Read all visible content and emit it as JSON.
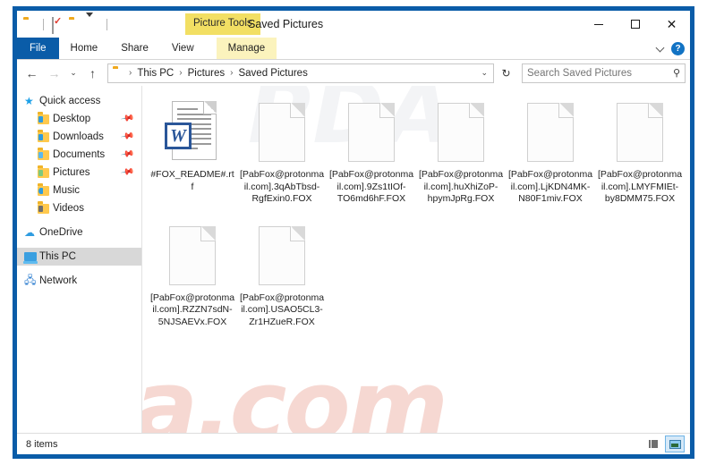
{
  "window": {
    "title": "Saved Pictures",
    "contextual_tab_label": "Picture Tools",
    "minimize": "–",
    "maximize": "□",
    "close": "✕"
  },
  "quick_access_toolbar": {
    "items": [
      {
        "name": "folder-icon",
        "label": ""
      },
      {
        "name": "properties-icon",
        "label": ""
      },
      {
        "name": "new-folder-icon",
        "label": ""
      },
      {
        "name": "customize-dropdown-icon",
        "label": ""
      }
    ]
  },
  "ribbon": {
    "file_tab": "File",
    "tabs": [
      "Home",
      "Share",
      "View"
    ],
    "manage_tab": "Manage",
    "help_label": "?"
  },
  "address_bar": {
    "back": "←",
    "forward": "→",
    "recent": "⌄",
    "up": "↑",
    "breadcrumbs": [
      "This PC",
      "Pictures",
      "Saved Pictures"
    ],
    "separator": "›",
    "history_chevron": "⌄",
    "refresh": "↻"
  },
  "search": {
    "placeholder": "Search Saved Pictures",
    "icon": "search-icon"
  },
  "sidebar": {
    "items": [
      {
        "label": "Quick access",
        "icon": "star-pin-icon",
        "indent": false,
        "pinned": false,
        "selected": false
      },
      {
        "label": "Desktop",
        "icon": "folder-desktop-icon",
        "indent": true,
        "pinned": true,
        "selected": false
      },
      {
        "label": "Downloads",
        "icon": "folder-downloads-icon",
        "indent": true,
        "pinned": true,
        "selected": false
      },
      {
        "label": "Documents",
        "icon": "folder-documents-icon",
        "indent": true,
        "pinned": true,
        "selected": false
      },
      {
        "label": "Pictures",
        "icon": "folder-pictures-icon",
        "indent": true,
        "pinned": true,
        "selected": false
      },
      {
        "label": "Music",
        "icon": "folder-music-icon",
        "indent": true,
        "pinned": false,
        "selected": false
      },
      {
        "label": "Videos",
        "icon": "folder-videos-icon",
        "indent": true,
        "pinned": false,
        "selected": false
      },
      {
        "label": "OneDrive",
        "icon": "cloud-icon",
        "indent": false,
        "pinned": false,
        "selected": false
      },
      {
        "label": "This PC",
        "icon": "computer-icon",
        "indent": false,
        "pinned": false,
        "selected": true
      },
      {
        "label": "Network",
        "icon": "network-icon",
        "indent": false,
        "pinned": false,
        "selected": false
      }
    ],
    "pin_glyph": "📌"
  },
  "files": [
    {
      "name": "#FOX_README#.rtf",
      "icon": "rtf-document-icon"
    },
    {
      "name": "[PabFox@protonmail.com].3qAbTbsd-RgfExin0.FOX",
      "icon": "blank-file-icon"
    },
    {
      "name": "[PabFox@protonmail.com].9Zs1tIOf-TO6md6hF.FOX",
      "icon": "blank-file-icon"
    },
    {
      "name": "[PabFox@protonmail.com].huXhiZoP-hpymJpRg.FOX",
      "icon": "blank-file-icon"
    },
    {
      "name": "[PabFox@protonmail.com].LjKDN4MK-N80F1miv.FOX",
      "icon": "blank-file-icon"
    },
    {
      "name": "[PabFox@protonmail.com].LMYFMIEt-by8DMM75.FOX",
      "icon": "blank-file-icon"
    },
    {
      "name": "[PabFox@protonmail.com].RZZN7sdN-5NJSAEVx.FOX",
      "icon": "blank-file-icon"
    },
    {
      "name": "[PabFox@protonmail.com].USAO5CL3-Zr1HZueR.FOX",
      "icon": "blank-file-icon"
    }
  ],
  "status_bar": {
    "item_count": "8 items",
    "details_view": "details-view-button",
    "large_icons_view": "large-icons-view-button"
  },
  "watermark": {
    "main": "rsa.com",
    "top": "PDA"
  },
  "colors": {
    "window_border": "#0a5ca8",
    "file_tab": "#0a5ca8",
    "contextual_highlight": "#f2df63",
    "manage_tab": "#fbf3bd",
    "selection": "#d8d8d8",
    "watermark": "#f6d8d2"
  }
}
